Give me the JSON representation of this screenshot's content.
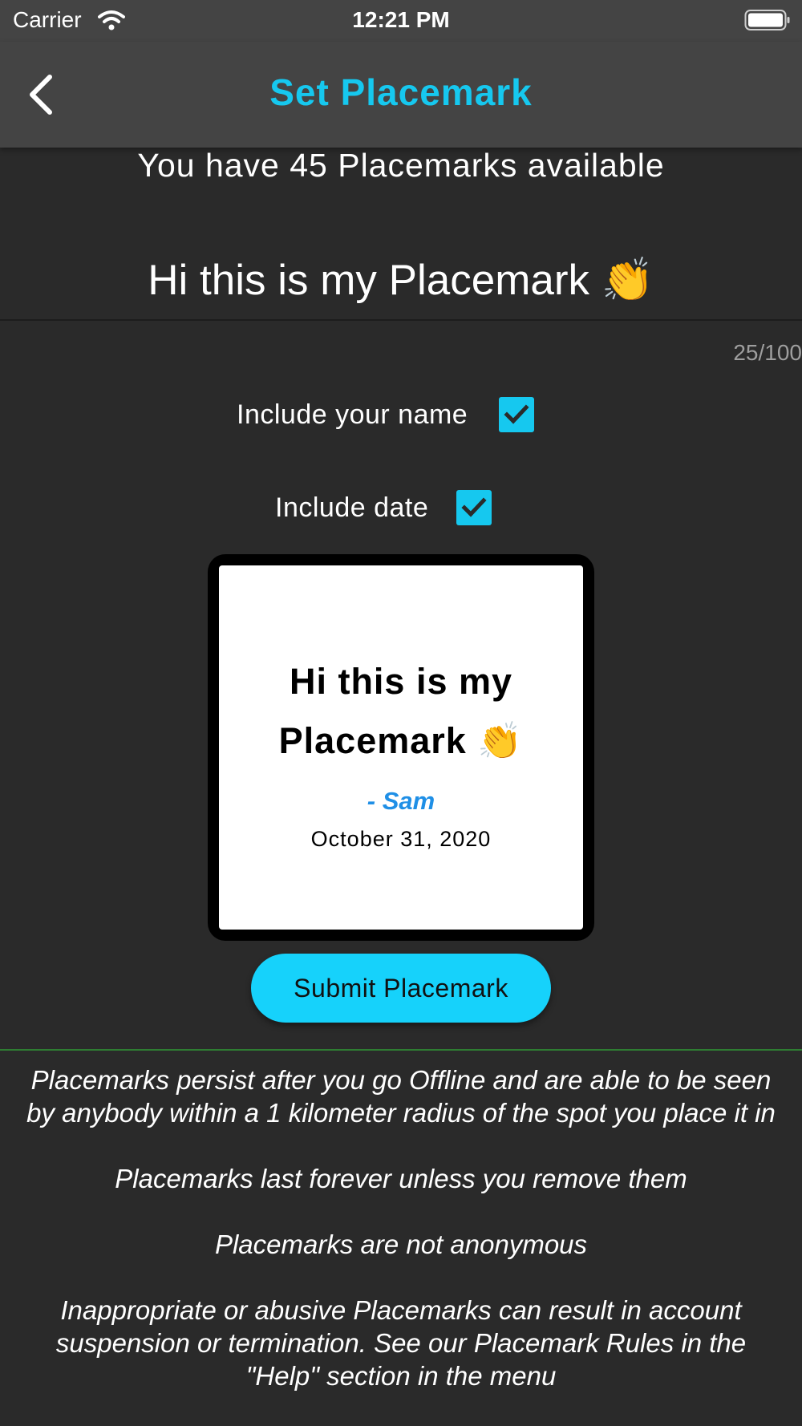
{
  "status_bar": {
    "carrier": "Carrier",
    "time": "12:21 PM",
    "icons": [
      "wifi-icon",
      "battery-icon"
    ]
  },
  "nav": {
    "title": "Set Placemark",
    "back_icon": "chevron-left-icon"
  },
  "available_text": "You have 45 Placemarks available",
  "message_input": {
    "value": "Hi this is my Placemark 👏"
  },
  "char_counter": "25/100",
  "options": {
    "include_name": {
      "label": "Include your name",
      "checked": true
    },
    "include_date": {
      "label": "Include date",
      "checked": true
    }
  },
  "preview": {
    "message": "Hi this is my Placemark 👏",
    "author": "- Sam",
    "date": "October 31, 2020"
  },
  "submit_label": "Submit Placemark",
  "info": {
    "line1": "Placemarks persist after you go Offline and are able to be seen by anybody within a 1 kilometer radius of the spot you place it in",
    "line2": "Placemarks last forever unless you remove them",
    "line3": "Placemarks are not anonymous",
    "line4": "Inappropriate or abusive Placemarks can result in account suspension or termination. See our Placemark Rules in the \"Help\" section in the menu"
  },
  "colors": {
    "accent": "#16c8ef",
    "button": "#16d2fb",
    "background": "#2a2a2a",
    "header": "#444444",
    "author": "#1f8fe6",
    "divider": "#2e7d32"
  }
}
